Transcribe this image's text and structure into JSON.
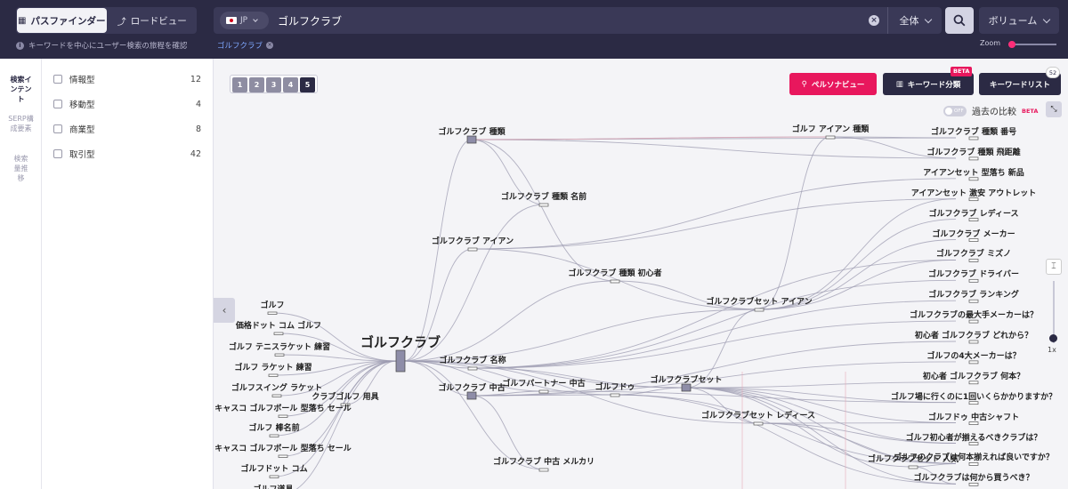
{
  "header": {
    "tabs": [
      {
        "label": "パスファインダー",
        "icon": "map-icon"
      },
      {
        "label": "ロードビュー",
        "icon": "route-icon"
      }
    ],
    "hint": "キーワードを中心にユーザー検索の旅程を確認",
    "country": "JP",
    "query": "ゴルフクラブ",
    "scope": "全体",
    "metric": "ボリューム",
    "active_tag": "ゴルフクラブ",
    "zoom_label": "Zoom"
  },
  "rail": [
    "検索インテント",
    "SERP構成要素",
    "検索量推移"
  ],
  "filters": [
    {
      "label": "情報型",
      "count": "12"
    },
    {
      "label": "移動型",
      "count": "4"
    },
    {
      "label": "商業型",
      "count": "8"
    },
    {
      "label": "取引型",
      "count": "42"
    }
  ],
  "pager": [
    "1",
    "2",
    "3",
    "4",
    "5"
  ],
  "active_page": "5",
  "toolbar": {
    "persona": "ペルソナビュー",
    "classify": "キーワード分類",
    "classify_badge": "BETA",
    "list": "キーワードリスト",
    "list_count": "52"
  },
  "compare": {
    "toggle": "OFF",
    "label": "過去の比較",
    "beta": "BETA"
  },
  "vzoom": "1x",
  "colors": {
    "header": "#2b2a44",
    "accent": "#e8175d",
    "node": "#8e8da8",
    "edge": "#9c9bb0",
    "highlight_edge": "#e4a9b8"
  },
  "graph": {
    "hub": {
      "label": "ゴルフクラブ"
    },
    "mid": [
      {
        "label": "ゴルフクラブ 種類"
      },
      {
        "label": "ゴルフクラブ 種類 名前"
      },
      {
        "label": "ゴルフクラブ アイアン"
      },
      {
        "label": "ゴルフクラブ 種類 初心者"
      },
      {
        "label": "ゴルフ アイアン 種類"
      },
      {
        "label": "ゴルフクラブセット アイアン"
      },
      {
        "label": "ゴルフクラブ 名称"
      },
      {
        "label": "ゴルフクラブ 中古"
      },
      {
        "label": "ゴルフパートナー 中古"
      },
      {
        "label": "ゴルフドゥ"
      },
      {
        "label": "ゴルフクラブセット"
      },
      {
        "label": "ゴルフクラブセット レディース"
      },
      {
        "label": "ゴルフクラブ 中古 メルカリ"
      },
      {
        "label": "ゴルフクラブセット 人気"
      }
    ],
    "left": [
      "ゴルフ",
      "価格ドット コム ゴルフ",
      "ゴルフ テニスラケット 練習",
      "ゴルフ ラケット 練習",
      "ゴルフスイング ラケット",
      "クラブゴルフ 用具",
      "キャスコ ゴルフボール 型落ち セール",
      "ゴルフ 棒名前",
      "キャスコ ゴルフボール 型落ち セール",
      "ゴルフドット コム",
      "ゴルフ道具"
    ],
    "right": [
      "ゴルフクラブ 種類 番号",
      "ゴルフクラブ 種類 飛距離",
      "アイアンセット 型落ち 新品",
      "アイアンセット 激安 アウトレット",
      "ゴルフクラブ レディース",
      "ゴルフクラブ メーカー",
      "ゴルフクラブ ミズノ",
      "ゴルフクラブ ドライバー",
      "ゴルフクラブ ランキング",
      "ゴルフクラブの最大手メーカーは？",
      "初心者 ゴルフクラブ どれから？",
      "ゴルフの4大メーカーは？",
      "初心者 ゴルフクラブ 何本？",
      "ゴルフ場に行くのに1回いくらかかりますか？",
      "ゴルフドゥ 中古シャフト",
      "ゴルフ初心者が揃えるべきクラブは？",
      "ゴルフのクラブは何本揃えれば良いですか？",
      "ゴルフクラブは何から買うべき？"
    ]
  }
}
